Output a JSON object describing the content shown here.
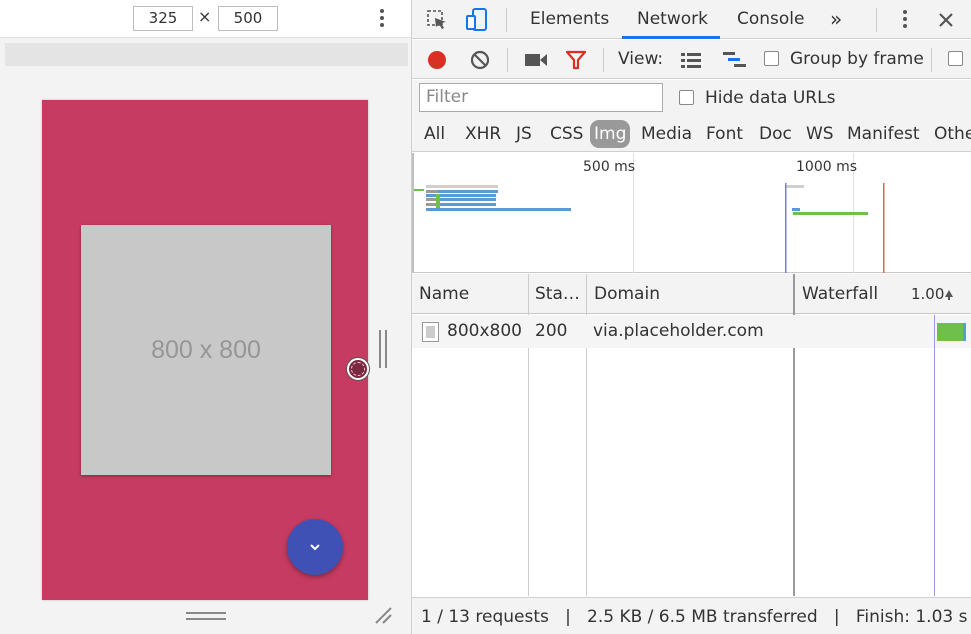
{
  "device_toolbar": {
    "width_value": "325",
    "height_value": "500",
    "times_symbol": "×",
    "more_icon": "more-vertical-icon"
  },
  "device_screen": {
    "background_color": "#c63b61",
    "placeholder_text": "800 x 800",
    "fab_color": "#3f51b5",
    "fab_icon": "chevron-down-icon"
  },
  "devtools_tabs": {
    "items": [
      "Elements",
      "Network",
      "Console"
    ],
    "active": "Network",
    "overflow_label": "»",
    "inspect_icon": "inspect-element-icon",
    "device_icon": "device-toggle-icon"
  },
  "network_toolbar": {
    "view_label": "View:",
    "group_by_frame_label": "Group by frame"
  },
  "filter": {
    "placeholder": "Filter",
    "hide_data_urls_label": "Hide data URLs",
    "types": [
      "All",
      "XHR",
      "JS",
      "CSS",
      "Img",
      "Media",
      "Font",
      "Doc",
      "WS",
      "Manifest",
      "Othe"
    ],
    "active_type": "Img"
  },
  "overview": {
    "tick_500": "500 ms",
    "tick_1000": "1000 ms"
  },
  "table": {
    "columns": [
      "Name",
      "Sta…",
      "Domain",
      "Waterfall"
    ],
    "waterfall_scale": "1.00",
    "rows": [
      {
        "name": "800x800",
        "status": "200",
        "domain": "via.placeholder.com"
      }
    ]
  },
  "status_bar": {
    "text": "1 / 13 requests   |   2.5 KB / 6.5 MB transferred   |   Finish: 1.03 s   …"
  },
  "colors": {
    "accent": "#1a73e8",
    "record": "#d93025",
    "waterfall_bar": "#6fbf4a",
    "overview_blue": "#5b9bd5"
  }
}
